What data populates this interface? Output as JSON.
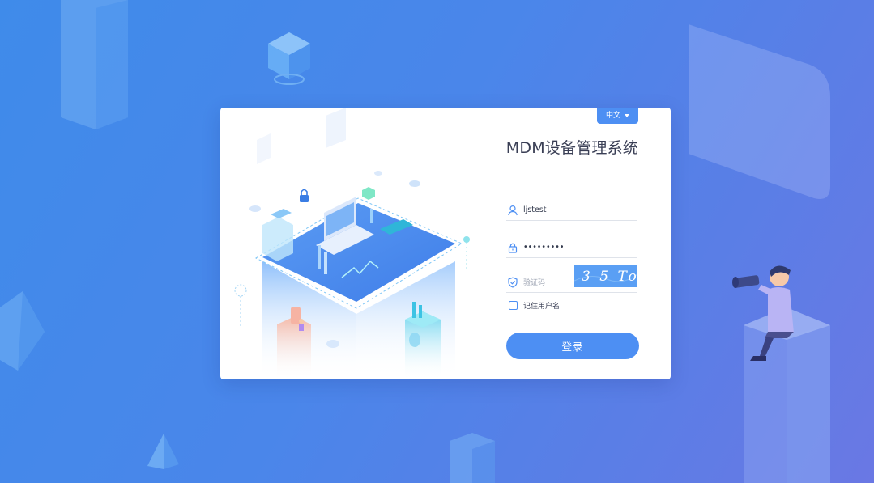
{
  "app": {
    "title": "MDM设备管理系统"
  },
  "language": {
    "current": "中文",
    "icon": "caret-down-icon"
  },
  "login": {
    "username": {
      "value": "ljstest",
      "icon": "user-icon"
    },
    "password": {
      "value": "•••••••••",
      "icon": "lock-icon"
    },
    "captcha": {
      "placeholder": "验证码",
      "icon": "shield-check-icon",
      "image_text": "3 5 To"
    },
    "remember_label": "记住用户名",
    "remember_checked": false,
    "submit_label": "登录"
  },
  "colors": {
    "accent": "#4d8ff3",
    "background_start": "#3f8bea",
    "background_end": "#6a78e4",
    "title_text": "#3a3f55"
  }
}
